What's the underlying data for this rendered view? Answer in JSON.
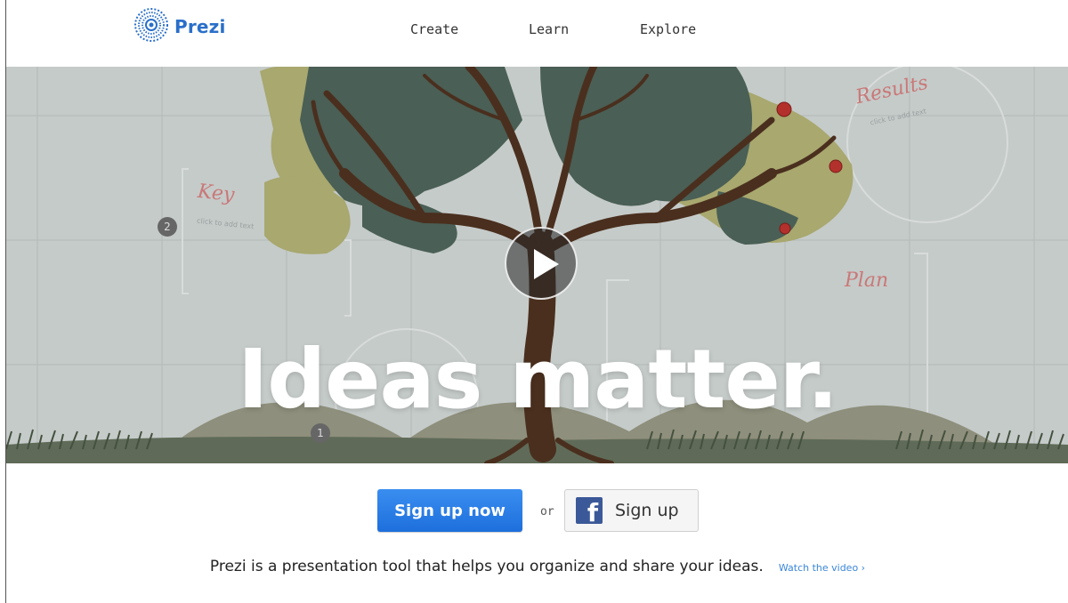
{
  "header": {
    "logo_text": "Prezi",
    "nav": [
      {
        "label": "Create"
      },
      {
        "label": "Learn"
      },
      {
        "label": "Explore"
      }
    ]
  },
  "hero": {
    "headline": "Ideas matter.",
    "labels": {
      "key": "Key",
      "results": "Results",
      "plan": "Plan",
      "click_to_add": "click to add text"
    },
    "steps": [
      "1",
      "2"
    ]
  },
  "cta": {
    "signup_label": "Sign up now",
    "or_label": "or",
    "fb_label": "Sign up",
    "fb_icon_glyph": "f"
  },
  "tagline": {
    "text": "Prezi is a presentation tool that helps you organize and share your ideas.",
    "link": "Watch the video ›"
  },
  "colors": {
    "brand_blue": "#2a6fc9",
    "signup_blue": "#1e6fdc",
    "facebook_blue": "#3b5998",
    "link_blue": "#3a87d8"
  }
}
